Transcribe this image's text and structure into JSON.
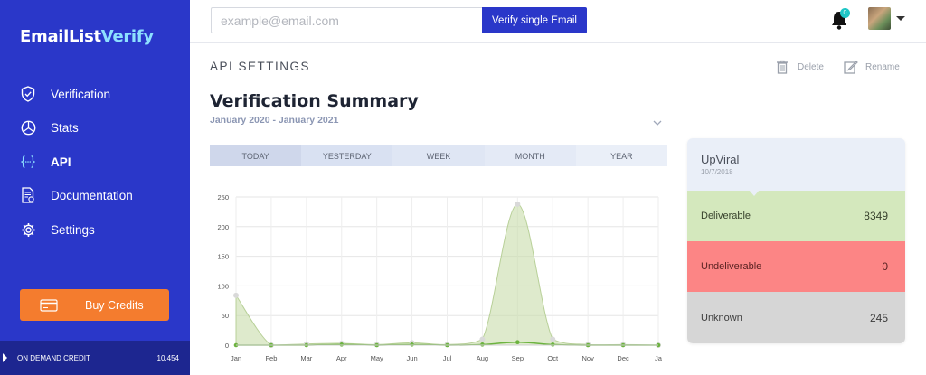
{
  "brand": {
    "name_main": "EmailList",
    "name_accent": "Verify"
  },
  "sidebar": {
    "items": [
      {
        "label": "Verification",
        "icon": "shield-check-icon"
      },
      {
        "label": "Stats",
        "icon": "pie-chart-icon"
      },
      {
        "label": "API",
        "icon": "code-braces-icon",
        "active": true
      },
      {
        "label": "Documentation",
        "icon": "document-icon"
      },
      {
        "label": "Settings",
        "icon": "gear-icon"
      }
    ],
    "buy_credits": "Buy Credits",
    "credit_label": "ON DEMAND CREDIT",
    "credit_value": "10,454"
  },
  "topbar": {
    "email_placeholder": "example@email.com",
    "email_value": "",
    "verify_button": "Verify single Email",
    "notification_count": "0"
  },
  "page": {
    "section_label": "API SETTINGS",
    "delete_label": "Delete",
    "rename_label": "Rename",
    "summary_title": "Verification Summary",
    "date_range": "January 2020 - January 2021"
  },
  "tabs": [
    "TODAY",
    "YESTERDAY",
    "WEEK",
    "MONTH",
    "YEAR"
  ],
  "chart_data": {
    "type": "area",
    "categories": [
      "Jan",
      "Feb",
      "Mar",
      "Apr",
      "May",
      "Jun",
      "Jul",
      "Aug",
      "Sep",
      "Oct",
      "Nov",
      "Dec",
      "Ja"
    ],
    "ylim": [
      0,
      250
    ],
    "yticks": [
      0,
      50,
      100,
      150,
      200,
      250
    ],
    "grid": true,
    "series": [
      {
        "values": [
          84,
          0,
          2,
          3,
          1,
          4,
          1,
          10,
          238,
          10,
          1,
          1,
          0
        ],
        "color": "#c8dcaa"
      },
      {
        "values": [
          0,
          0,
          0,
          1,
          0,
          1,
          0,
          1,
          5,
          1,
          0,
          0,
          0
        ],
        "color": "#6cb33f"
      }
    ]
  },
  "card": {
    "title": "UpViral",
    "date": "10/7/2018",
    "rows": [
      {
        "label": "Deliverable",
        "value": "8349"
      },
      {
        "label": "Undeliverable",
        "value": "0"
      },
      {
        "label": "Unknown",
        "value": "245"
      }
    ]
  },
  "colors": {
    "sidebar": "#2a37c9",
    "accent_orange": "#f47c2e",
    "deliverable": "#d4e8bd",
    "undeliverable": "#fc8585",
    "unknown": "#d6d6d6"
  }
}
